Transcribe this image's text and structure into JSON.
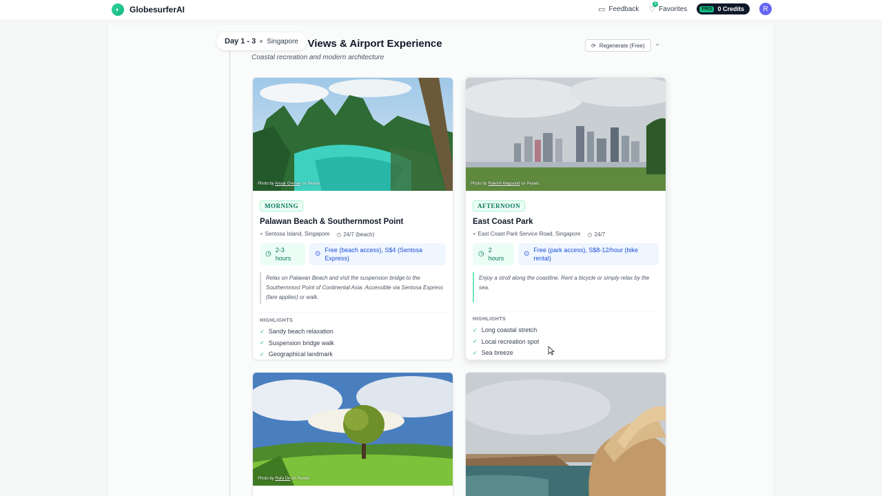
{
  "nav": {
    "brand": "GlobesurferAI",
    "feedback": "Feedback",
    "favorites": "Favorites",
    "favorites_count": "5",
    "pro": "PRO",
    "credits": "0 Credits",
    "avatar_initial": "R"
  },
  "day": {
    "label": "Day 1 - 3",
    "location": "Singapore",
    "title": "nd Views & Airport Experience",
    "subtitle": "Coastal recreation and modern architecture",
    "regenerate": "Regenerate (Free)"
  },
  "cards": [
    {
      "photo_credit_prefix": "Photo by",
      "photographer": "Anuar Gresan",
      "photo_credit_suffix": "on Pexels",
      "time_of_day": "MORNING",
      "name": "Palawan Beach & Southernmost Point",
      "address": "Sentosa Island, Singapore",
      "hours": "24/7 (beach)",
      "duration": "2-3 hours",
      "cost": "Free (beach access), S$4 (Sentosa Express)",
      "description": "Relax on Palawan Beach and visit the suspension bridge to the Southernmost Point of Continental Asia. Accessible via Sentosa Express (fare applies) or walk.",
      "highlights_label": "HIGHLIGHTS",
      "highlights": [
        "Sandy beach relaxation",
        "Suspension bridge walk",
        "Geographical landmark"
      ]
    },
    {
      "photo_credit_prefix": "Photo by",
      "photographer": "Rawish Magsood",
      "photo_credit_suffix": "on Pexels",
      "time_of_day": "AFTERNOON",
      "name": "East Coast Park",
      "address": "East Coast Park Service Road, Singapore",
      "hours": "24/7",
      "duration": "2 hours",
      "cost": "Free (park access), S$8-12/hour (bike rental)",
      "description": "Enjoy a stroll along the coastline. Rent a bicycle or simply relax by the sea.",
      "highlights_label": "HIGHLIGHTS",
      "highlights": [
        "Long coastal stretch",
        "Local recreation spot",
        "Sea breeze"
      ]
    },
    {
      "photo_credit_prefix": "Photo by",
      "photographer": "Rafa De",
      "photo_credit_suffix": "on Pexels"
    }
  ]
}
